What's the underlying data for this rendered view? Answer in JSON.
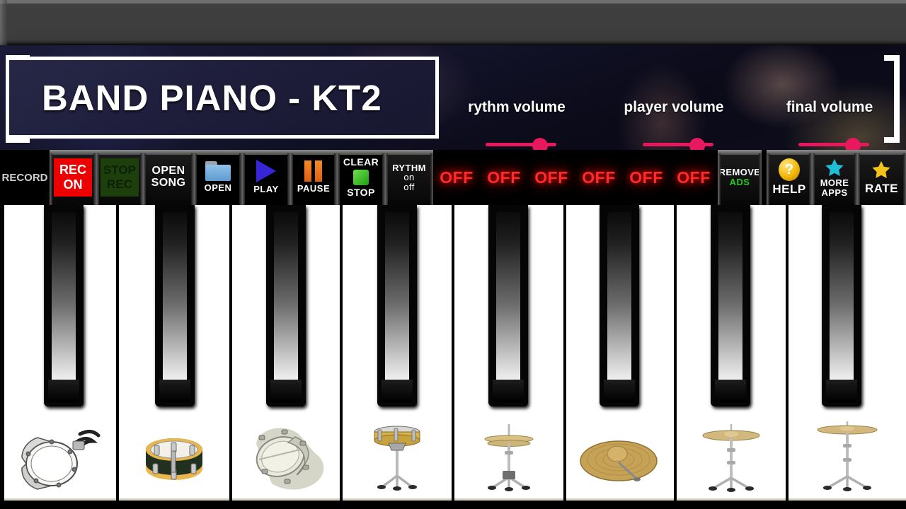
{
  "app": {
    "title": "BAND PIANO - KT2"
  },
  "sliders": [
    {
      "name": "rythm-volume",
      "label": "rythm volume",
      "value": 80,
      "min": 0,
      "max": 100,
      "ticks": [
        "0",
        "20",
        "40",
        "60",
        "80",
        "100"
      ],
      "color": "#e8185f"
    },
    {
      "name": "player-volume",
      "label": "player volume",
      "value": 80,
      "min": 0,
      "max": 100,
      "ticks": [
        "0",
        "20",
        "40",
        "60",
        "80",
        "100"
      ],
      "color": "#e8185f"
    },
    {
      "name": "final-volume",
      "label": "final volume",
      "value": 80,
      "min": 0,
      "max": 100,
      "ticks": [
        "0",
        "20",
        "40",
        "60",
        "80",
        "100"
      ],
      "color": "#e8185f"
    }
  ],
  "toolbar": {
    "record_label": "RECORD",
    "rec_on": {
      "line1": "REC",
      "line2": "ON",
      "bg": "#ee0000",
      "fg": "#ffffff"
    },
    "stop_rec": {
      "line1": "STOP",
      "line2": "REC",
      "bg": "#1d3f0b",
      "fg": "#0d1f05"
    },
    "open_song": {
      "line1": "OPEN",
      "line2": "SONG"
    },
    "open": {
      "caption": "OPEN",
      "icon": "folder-icon"
    },
    "play": {
      "caption": "PLAY",
      "icon": "play-icon"
    },
    "pause": {
      "caption": "PAUSE",
      "icon": "pause-icon"
    },
    "clear_stop": {
      "line1": "CLEAR",
      "line2": "STOP",
      "icon": "stop-square-icon"
    },
    "rythm": {
      "line1": "RYTHM",
      "line2": "on",
      "line3": "off"
    },
    "off_indicators": [
      "OFF",
      "OFF",
      "OFF",
      "OFF",
      "OFF",
      "OFF"
    ],
    "remove_ads": {
      "line1": "REMOVE",
      "line2": "ADS",
      "line1_color": "#ffffff",
      "line2_color": "#22cc22"
    },
    "help": {
      "label": "HELP",
      "icon": "question-circle-icon",
      "glyph": "?"
    },
    "more_apps": {
      "line1": "MORE",
      "line2": "APPS",
      "icon": "star-icon",
      "color": "#1fbdd6"
    },
    "rate": {
      "label": "RATE",
      "icon": "star-icon",
      "color": "#f2c41a"
    }
  },
  "keyboard": {
    "white_keys": [
      {
        "index": 1,
        "instrument": "bass-drum"
      },
      {
        "index": 2,
        "instrument": "marching-snare-drum"
      },
      {
        "index": 3,
        "instrument": "floor-tom"
      },
      {
        "index": 4,
        "instrument": "snare-drum-on-stand"
      },
      {
        "index": 5,
        "instrument": "hi-hat"
      },
      {
        "index": 6,
        "instrument": "ride-cymbal"
      },
      {
        "index": 7,
        "instrument": "crash-cymbal-stand"
      },
      {
        "index": 8,
        "instrument": "crash-cymbal-stand-tall"
      }
    ],
    "black_key_count": 8
  }
}
